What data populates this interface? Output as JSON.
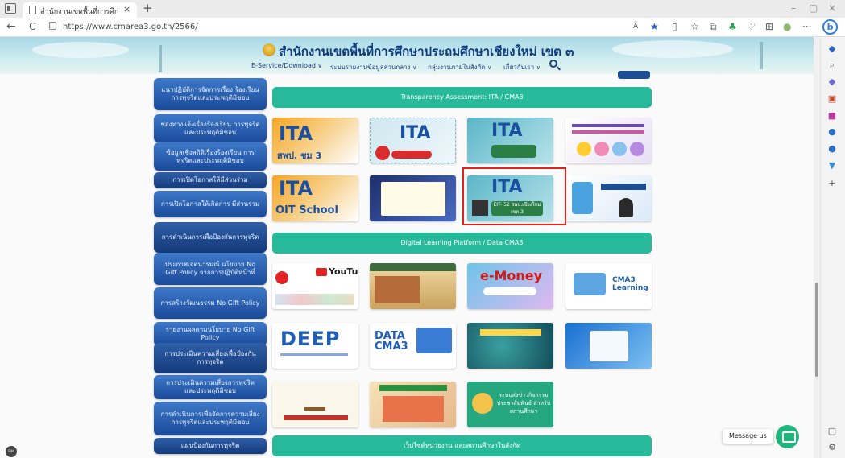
{
  "browser": {
    "tab_title": "สำนักงานเขตพื้นที่การศึกษาประถมศึกษาเชียงใหม่ เขต",
    "tab_close": "×",
    "new_tab": "+",
    "url": "https://www.cmarea3.go.th/2566/",
    "minimize": "–",
    "restore": "▢",
    "close": "×",
    "back": "←",
    "refresh": "C",
    "read_aloud": "Ã",
    "favorite": "★",
    "bing": "b"
  },
  "site": {
    "title": "สำนักงานเขตพื้นที่การศึกษาประถมศึกษาเชียงใหม่ เขต ๓",
    "menu": [
      {
        "label": "E-Service/Download"
      },
      {
        "label": "ระบบรายงานข้อมูลส่วนกลาง"
      },
      {
        "label": "กลุ่มงานภายในสังกัด"
      },
      {
        "label": "เกี่ยวกับเรา"
      }
    ],
    "chevron": "∨"
  },
  "sidebar": {
    "items": [
      {
        "label": "แนวปฏิบัติการจัดการเรื่อง ร้องเรียนการทุจริตและประพฤติมิชอบ"
      },
      {
        "label": "ช่องทางแจ้งเรื่องร้องเรียน การทุจริตและประพฤติมิชอบ"
      },
      {
        "label": "ข้อมูลเชิงสถิติเรื่องร้องเรียน การทุจริตและประพฤติมิชอบ"
      },
      {
        "label": "การเปิดโอกาสให้มีส่วนร่วม"
      },
      {
        "label": "การเปิดโอกาสให้เกิดการ มีส่วนร่วม"
      },
      {
        "label": "การดำเนินการเพื่อป้องกันการทุจริต"
      },
      {
        "label": "ประกาศเจตนารมณ์ นโยบาย No Gift Policy จากการปฏิบัติหน้าที่"
      },
      {
        "label": "การสร้างวัฒนธรรม No Gift Policy"
      },
      {
        "label": "รายงานผลตามนโยบาย No Gift Policy"
      },
      {
        "label": "การประเมินความเสี่ยงเพื่อป้องกันการทุจริต"
      },
      {
        "label": "การประเมินความเสี่ยงการทุจริตและประพฤติมิชอบ"
      },
      {
        "label": "การดำเนินการเพื่อจัดการความเสี่ยง การทุจริตและประพฤติมิชอบ"
      },
      {
        "label": "แผนป้องกันการทุจริต"
      }
    ]
  },
  "sections": {
    "ita": "Transparency Assessment: ITA / CMA3",
    "digital": "Digital Learning Platform / Data CMA3",
    "links": "เว็บไซต์หน่วยงาน และสถานศึกษาในสังกัด"
  },
  "banners": {
    "ita1_caption": "สพป. ชม 3",
    "oit_caption": "OIT School",
    "eit_caption": "EIT- 52 สพป.เชียงใหม่ เขต 3",
    "youtube": "YouTube",
    "emoney": "e-Money",
    "cma3": "CMA3 Learning",
    "deep": "DEEP",
    "data": "DATA CMA3",
    "news": "ระบบส่งข่าวกิจกรรม ประชาสัมพันธ์ สำหรับสถานศึกษา"
  },
  "messenger": {
    "label": "Message us"
  },
  "edit_badge": "Edit",
  "colors": {
    "section_header": "#26b99a",
    "sidebar_button": "#1b4a9a",
    "highlight": "#e0231b",
    "title": "#0d3a7a"
  }
}
